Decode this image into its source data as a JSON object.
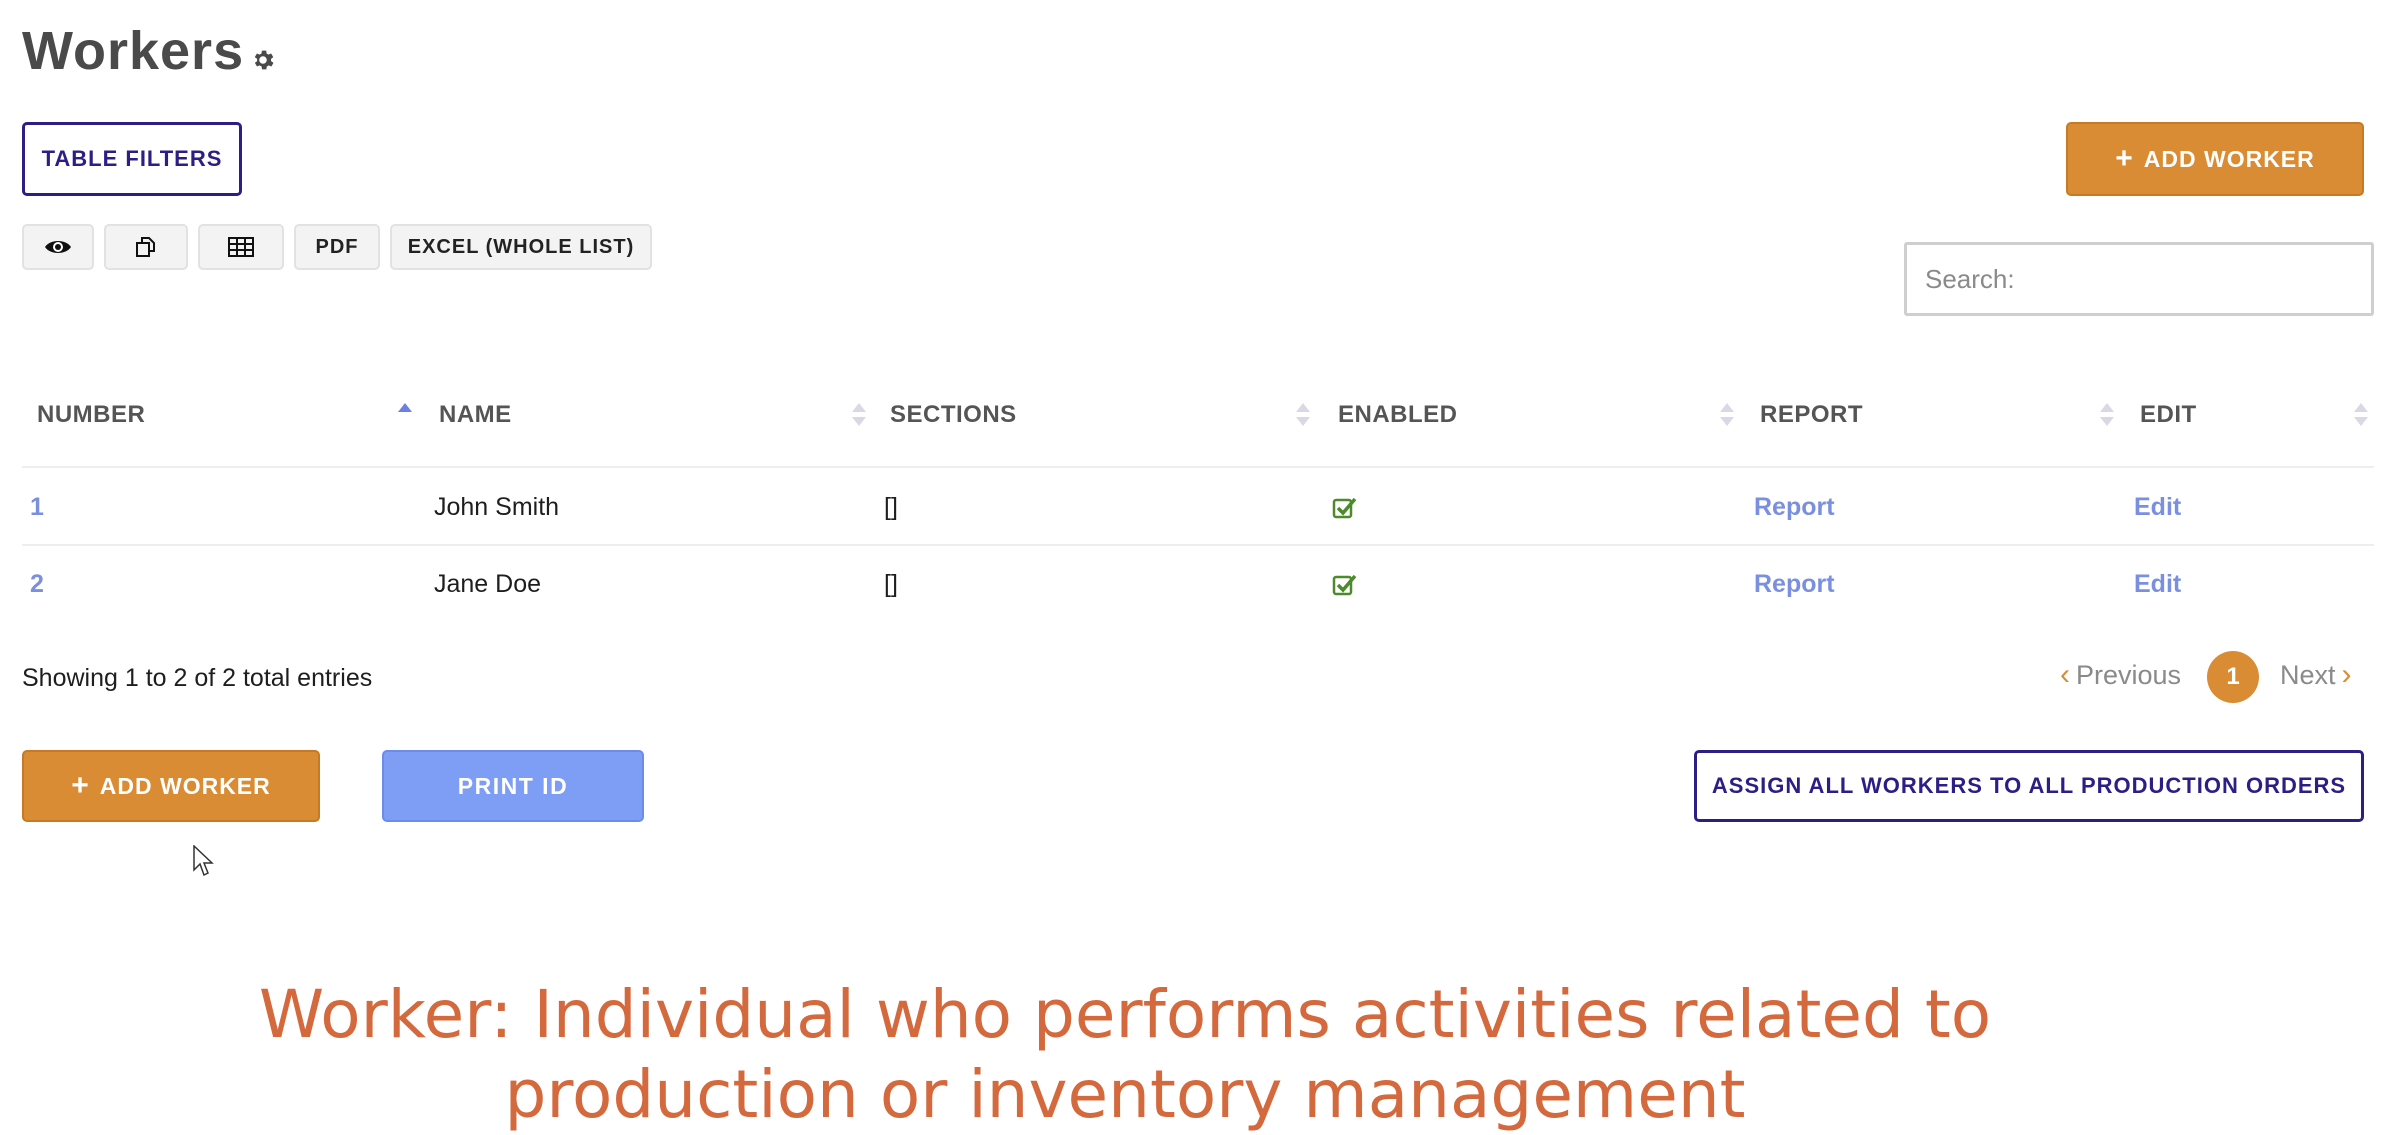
{
  "page": {
    "title": "Workers"
  },
  "toolbar": {
    "table_filters": "TABLE FILTERS",
    "add_worker": "ADD WORKER",
    "pdf": "PDF",
    "excel": "EXCEL (WHOLE LIST)",
    "icons": [
      "eye-icon",
      "copy-icon",
      "table-icon"
    ]
  },
  "search": {
    "placeholder": "Search:"
  },
  "table": {
    "columns": [
      "NUMBER",
      "NAME",
      "SECTIONS",
      "ENABLED",
      "REPORT",
      "EDIT"
    ],
    "sorted_column": "NUMBER",
    "rows": [
      {
        "number": "1",
        "name": "John Smith",
        "sections": "[]",
        "enabled": true,
        "report": "Report",
        "edit": "Edit"
      },
      {
        "number": "2",
        "name": "Jane Doe",
        "sections": "[]",
        "enabled": true,
        "report": "Report",
        "edit": "Edit"
      }
    ]
  },
  "info": {
    "text": "Showing 1 to 2 of 2 total entries"
  },
  "pagination": {
    "previous": "Previous",
    "current": "1",
    "next": "Next"
  },
  "actions": {
    "add_worker": "ADD WORKER",
    "print_id": "PRINT ID",
    "assign_all": "ASSIGN ALL WORKERS TO ALL PRODUCTION ORDERS"
  },
  "caption": {
    "line1": "Worker: Individual who performs activities related to",
    "line2": "production or inventory management"
  },
  "colors": {
    "accent_orange": "#d98c34",
    "navy": "#2b1f86",
    "link_blue": "#7b8fe0",
    "print_blue": "#7e9df5",
    "check_green": "#4c8a2c",
    "caption": "#d4693d"
  }
}
